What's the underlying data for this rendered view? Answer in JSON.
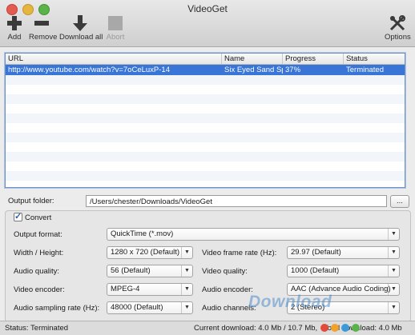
{
  "window": {
    "title": "VideoGet"
  },
  "toolbar": {
    "add": "Add",
    "remove": "Remove",
    "download_all": "Download all",
    "abort": "Abort",
    "options": "Options"
  },
  "table": {
    "columns": [
      "URL",
      "Name",
      "Progress",
      "Status"
    ],
    "rows": [
      {
        "url": "http://www.youtube.com/watch?v=7oCeLuxP-14",
        "name": "Six Eyed Sand Spi",
        "progress": "37%",
        "status": "Terminated"
      }
    ]
  },
  "output": {
    "label": "Output folder:",
    "path": "/Users/chester/Downloads/VideoGet",
    "browse": "..."
  },
  "convert": {
    "label": "Convert",
    "checked": true,
    "output_format_label": "Output format:",
    "output_format": "QuickTime (*.mov)",
    "size_label": "Width / Height:",
    "size": "1280 x 720 (Default)",
    "frame_rate_label": "Video frame rate (Hz):",
    "frame_rate": "29.97 (Default)",
    "audio_quality_label": "Audio quality:",
    "audio_quality": "56 (Default)",
    "video_quality_label": "Video quality:",
    "video_quality": "1000 (Default)",
    "video_encoder_label": "Video encoder:",
    "video_encoder": "MPEG-4",
    "audio_encoder_label": "Audio encoder:",
    "audio_encoder": "AAC (Advance Audio Coding)",
    "sampling_label": "Audio sampling rate (Hz):",
    "sampling": "48000 (Default)",
    "channels_label": "Audio channels:",
    "channels": "2 (Stereo)"
  },
  "status": {
    "status": "Status: Terminated",
    "current": "Current download: 4.0 Mb / 10.7 Mb,",
    "total": "Total download: 4.0 Mb"
  },
  "watermark": "Download",
  "colors": {
    "selection": "#3875d7",
    "table_border": "#6d90c7"
  }
}
